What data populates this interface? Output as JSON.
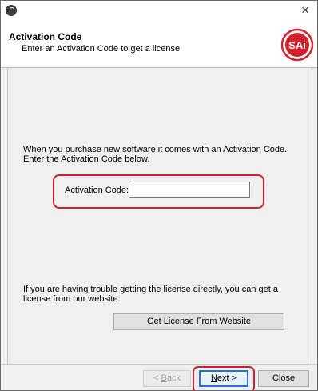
{
  "window": {
    "close_glyph": "×"
  },
  "header": {
    "title": "Activation Code",
    "subtitle": "Enter an Activation Code to get a license",
    "logo_text": "SAi",
    "logo_color": "#d4202e"
  },
  "main": {
    "intro_text": "When you purchase new software it comes with an Activation Code.  Enter the Activation Code below.",
    "code_label": "Activation Code:",
    "code_value": "",
    "trouble_text": "If you are having trouble getting the license directly, you can get a license from our website.",
    "website_button_label": "Get License From Website"
  },
  "footer": {
    "back_prefix": "< ",
    "back_accel": "B",
    "back_rest": "ack",
    "next_accel": "N",
    "next_rest": "ext >",
    "close_label": "Close"
  },
  "colors": {
    "highlight": "#d4202e",
    "focus_border": "#2a72d8"
  },
  "icons": {
    "app": "app-icon",
    "close": "close-icon",
    "logo": "sai-logo"
  }
}
